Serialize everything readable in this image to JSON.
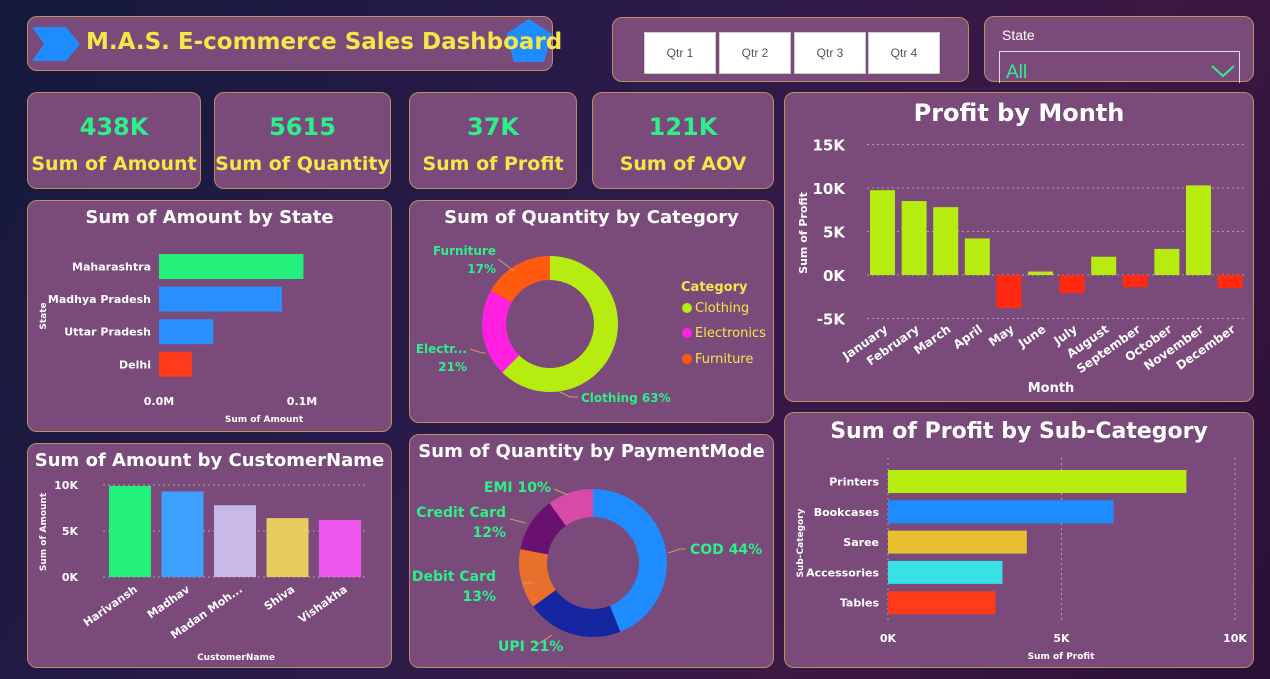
{
  "header": {
    "title": "M.A.S. E-commerce Sales Dashboard"
  },
  "quarters": [
    "Qtr 1",
    "Qtr 2",
    "Qtr 3",
    "Qtr 4"
  ],
  "state_filter": {
    "label": "State",
    "value": "All"
  },
  "kpis": [
    {
      "value": "438K",
      "label": "Sum of Amount"
    },
    {
      "value": "5615",
      "label": "Sum of Quantity"
    },
    {
      "value": "37K",
      "label": "Sum of Profit"
    },
    {
      "value": "121K",
      "label": "Sum of AOV"
    }
  ],
  "colors": {
    "green": "#23f07a",
    "blue": "#2a8fff",
    "lime": "#b6ec10",
    "red": "#ff3a1a",
    "yellow": "#f6e64a",
    "magenta": "#ff20e0",
    "orange": "#ff5a10"
  },
  "chart_data": [
    {
      "id": "state",
      "type": "bar",
      "orientation": "horizontal",
      "title": "Sum of Amount by State",
      "xlabel": "Sum of Amount",
      "ylabel": "State",
      "categories": [
        "Maharashtra",
        "Madhya Pradesh",
        "Uttar Pradesh",
        "Delhi"
      ],
      "values": [
        101000,
        86000,
        38000,
        23000
      ],
      "colors": [
        "#23f07a",
        "#2a8fff",
        "#2a8fff",
        "#ff3a1a"
      ],
      "xticks": [
        "0.0M",
        "0.1M"
      ],
      "xlim": [
        0,
        100000
      ]
    },
    {
      "id": "category",
      "type": "pie",
      "title": "Sum of Quantity by Category",
      "legend_title": "Category",
      "categories": [
        "Clothing",
        "Electronics",
        "Furniture"
      ],
      "values": [
        63,
        21,
        17
      ],
      "colors": [
        "#b6ec10",
        "#ff20e0",
        "#ff5a10"
      ],
      "slice_labels": [
        "Clothing 63%",
        "Electr... 21%",
        "Furniture 17%"
      ]
    },
    {
      "id": "payment",
      "type": "pie",
      "title": "Sum of Quantity by PaymentMode",
      "categories": [
        "COD",
        "UPI",
        "Debit Card",
        "Credit Card",
        "EMI"
      ],
      "values": [
        44,
        21,
        13,
        12,
        10
      ],
      "colors": [
        "#1e8bff",
        "#1626a0",
        "#e8702c",
        "#6a1070",
        "#d84aa8"
      ],
      "slice_labels": [
        "COD 44%",
        "UPI 21%",
        "Debit Card 13%",
        "Credit Card 12%",
        "EMI 10%"
      ]
    },
    {
      "id": "customer",
      "type": "bar",
      "title": "Sum of Amount by CustomerName",
      "xlabel": "CustomerName",
      "ylabel": "Sum of Amount",
      "categories": [
        "Harivansh",
        "Madhav",
        "Madan Moh...",
        "Shiva",
        "Vishakha"
      ],
      "values": [
        9900,
        9300,
        7800,
        6400,
        6200
      ],
      "colors": [
        "#23f07a",
        "#3ea0ff",
        "#c8b8e8",
        "#e8cc60",
        "#ee58f0"
      ],
      "yticks": [
        "0K",
        "5K",
        "10K"
      ],
      "ylim": [
        0,
        10000
      ]
    },
    {
      "id": "month",
      "type": "bar",
      "title": "Profit by Month",
      "xlabel": "Month",
      "ylabel": "Sum of Profit",
      "categories": [
        "January",
        "February",
        "March",
        "April",
        "May",
        "June",
        "July",
        "August",
        "September",
        "October",
        "November",
        "December"
      ],
      "values": [
        9750,
        8500,
        7800,
        4200,
        -3800,
        400,
        -2100,
        2100,
        -1400,
        3000,
        10300,
        -1500
      ],
      "positive_color": "#b6ec10",
      "negative_color": "#ff2a10",
      "yticks": [
        "-5K",
        "0K",
        "5K",
        "10K",
        "15K"
      ],
      "ylim": [
        -5000,
        15000
      ]
    },
    {
      "id": "subcat",
      "type": "bar",
      "orientation": "horizontal",
      "title": "Sum of Profit by Sub-Category",
      "xlabel": "Sum of Profit",
      "ylabel": "Sub-Category",
      "categories": [
        "Printers",
        "Bookcases",
        "Saree",
        "Accessories",
        "Tables"
      ],
      "values": [
        8600,
        6500,
        4000,
        3300,
        3100
      ],
      "colors": [
        "#b6ec10",
        "#1e8bff",
        "#e8c030",
        "#38e0e8",
        "#ff3a1a"
      ],
      "xticks": [
        "0K",
        "5K",
        "10K"
      ],
      "xlim": [
        0,
        10000
      ]
    }
  ]
}
